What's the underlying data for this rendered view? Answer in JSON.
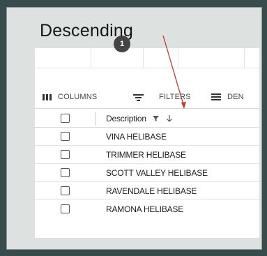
{
  "callout": {
    "title": "Descending"
  },
  "toolbar": {
    "columns_label": "COLUMNS",
    "filters_label": "FILTERS",
    "density_label": "DEN",
    "filter_count": "1"
  },
  "table": {
    "header": "Description",
    "sort": "descending",
    "rows": [
      "VINA HELIBASE",
      "TRIMMER HELIBASE",
      "SCOTT VALLEY HELIBASE",
      "RAVENDALE HELIBASE",
      "RAMONA HELIBASE"
    ]
  },
  "colors": {
    "background": "#3a4b4d",
    "panel": "#dde2e0",
    "arrow": "#c0392b",
    "badge": "#444444"
  }
}
